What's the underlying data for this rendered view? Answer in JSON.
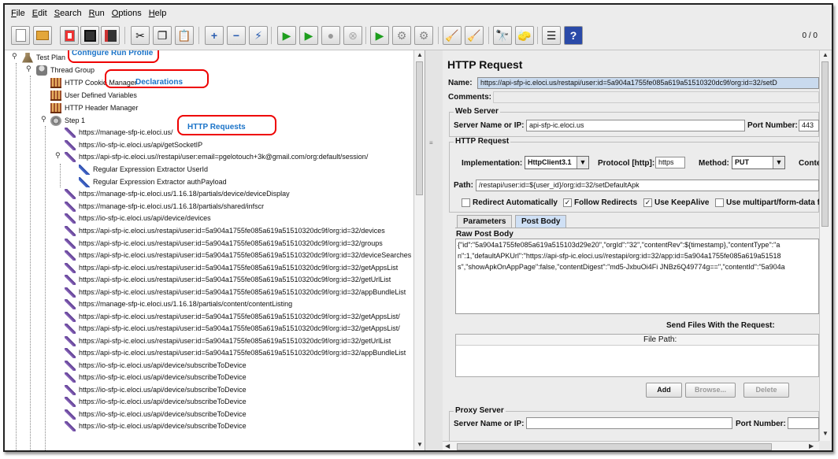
{
  "menu": [
    "File",
    "Edit",
    "Search",
    "Run",
    "Options",
    "Help"
  ],
  "toolbar": {
    "counter": "0 / 0",
    "icons": [
      "new-icon",
      "open-icon",
      "templates-icon",
      "save-icon",
      "save-as-icon",
      "cut-icon",
      "copy-icon",
      "paste-icon",
      "expand-icon",
      "collapse-icon",
      "toggle-icon",
      "start-icon",
      "start-no-pause-icon",
      "stop-icon",
      "shutdown-icon",
      "remote-start-icon",
      "remote-stop-icon",
      "remote-shutdown-icon",
      "clear-icon",
      "clear-all-icon",
      "search-icon",
      "reset-search-icon",
      "function-helper-icon",
      "help-icon"
    ]
  },
  "tree": {
    "test_plan": "Test Plan",
    "thread_group": "Thread Group",
    "cookie_manager": "HTTP Cookie Manager",
    "user_vars": "User Defined Variables",
    "header_manager": "HTTP Header Manager",
    "step": "Step 1",
    "samplers": [
      "https://manage-sfp-ic.eloci.us/",
      "https://io-sfp-ic.eloci.us/api/getSocketIP",
      "https://api-sfp-ic.eloci.us//restapi/user:email=pgelotouch+3k@gmail.com/org:default/session/",
      "https://manage-sfp-ic.eloci.us/1.16.18/partials/device/deviceDisplay",
      "https://manage-sfp-ic.eloci.us/1.16.18/partials/shared/infscr",
      "https://io-sfp-ic.eloci.us/api/device/devices",
      "https://api-sfp-ic.eloci.us/restapi/user:id=5a904a1755fe085a619a51510320dc9f/org:id=32/devices",
      "https://api-sfp-ic.eloci.us/restapi/user:id=5a904a1755fe085a619a51510320dc9f/org:id=32/groups",
      "https://api-sfp-ic.eloci.us/restapi/user:id=5a904a1755fe085a619a51510320dc9f/org:id=32/deviceSearches",
      "https://api-sfp-ic.eloci.us/restapi/user:id=5a904a1755fe085a619a51510320dc9f/org:id=32/getAppsList",
      "https://api-sfp-ic.eloci.us/restapi/user:id=5a904a1755fe085a619a51510320dc9f/org:id=32/getUrlList",
      "https://api-sfp-ic.eloci.us/restapi/user:id=5a904a1755fe085a619a51510320dc9f/org:id=32/appBundleList",
      "https://manage-sfp-ic.eloci.us/1.16.18/partials/content/contentListing",
      "https://api-sfp-ic.eloci.us/restapi/user:id=5a904a1755fe085a619a51510320dc9f/org:id=32/getAppsList/",
      "https://api-sfp-ic.eloci.us/restapi/user:id=5a904a1755fe085a619a51510320dc9f/org:id=32/getAppsList/",
      "https://api-sfp-ic.eloci.us/restapi/user:id=5a904a1755fe085a619a51510320dc9f/org:id=32/getUrlList",
      "https://api-sfp-ic.eloci.us/restapi/user:id=5a904a1755fe085a619a51510320dc9f/org:id=32/appBundleList",
      "https://io-sfp-ic.eloci.us/api/device/subscribeToDevice",
      "https://io-sfp-ic.eloci.us/api/device/subscribeToDevice",
      "https://io-sfp-ic.eloci.us/api/device/subscribeToDevice",
      "https://io-sfp-ic.eloci.us/api/device/subscribeToDevice",
      "https://io-sfp-ic.eloci.us/api/device/subscribeToDevice",
      "https://io-sfp-ic.eloci.us/api/device/subscribeToDevice"
    ],
    "extractors": [
      "Regular Expression Extractor UserId",
      "Regular Expression Extractor authPayload"
    ]
  },
  "annotations": {
    "run_profile": "Configure Run Profile",
    "declarations": "Declarations",
    "http_requests": "HTTP Requests"
  },
  "panel": {
    "title": "HTTP Request",
    "name_label": "Name:",
    "name_value": "https://api-sfp-ic.eloci.us/restapi/user:id=5a904a1755fe085a619a51510320dc9f/org:id=32/setD",
    "comments_label": "Comments:",
    "web_server": "Web Server",
    "server_label": "Server Name or IP:",
    "server_value": "api-sfp-ic.eloci.us",
    "port_label": "Port Number:",
    "port_value": "443",
    "http_request": "HTTP Request",
    "impl_label": "Implementation:",
    "impl_value": "HttpClient3.1",
    "protocol_label": "Protocol [http]:",
    "protocol_value": "https",
    "method_label": "Method:",
    "method_value": "PUT",
    "content_label": "Conte",
    "path_label": "Path:",
    "path_value": "/restapi/user:id=${user_id}/org:id=32/setDefaultApk",
    "redirect_auto": "Redirect Automatically",
    "follow_redirects": "Follow Redirects",
    "keepalive": "Use KeepAlive",
    "multipart": "Use multipart/form-data f",
    "tab_params": "Parameters",
    "tab_body": "Post Body",
    "raw_label": "Raw Post Body",
    "body_lines": [
      "{\"id\":\"5a904a1755fe085a619a515103d29e20\",\"orgId\":\"32\",\"contentRev\":${timestamp},\"contentType\":\"a",
      "n\":1,\"defaultAPKUrl\":\"https://api-sfp-ic.eloci.us//restapi/org:id=32/app:id=5a904a1755fe085a619a51518",
      "s\",\"showApkOnAppPage\":false,\"contentDigest\":\"md5-JxbuOi4Fi JNBz6Q49774g==\",\"contentId\":\"5a904a"
    ],
    "send_files": "Send Files With the Request:",
    "file_path": "File Path:",
    "add": "Add",
    "browse": "Browse...",
    "delete": "Delete",
    "proxy": "Proxy Server",
    "proxy_server_label": "Server Name or IP:",
    "proxy_port_label": "Port Number:"
  }
}
